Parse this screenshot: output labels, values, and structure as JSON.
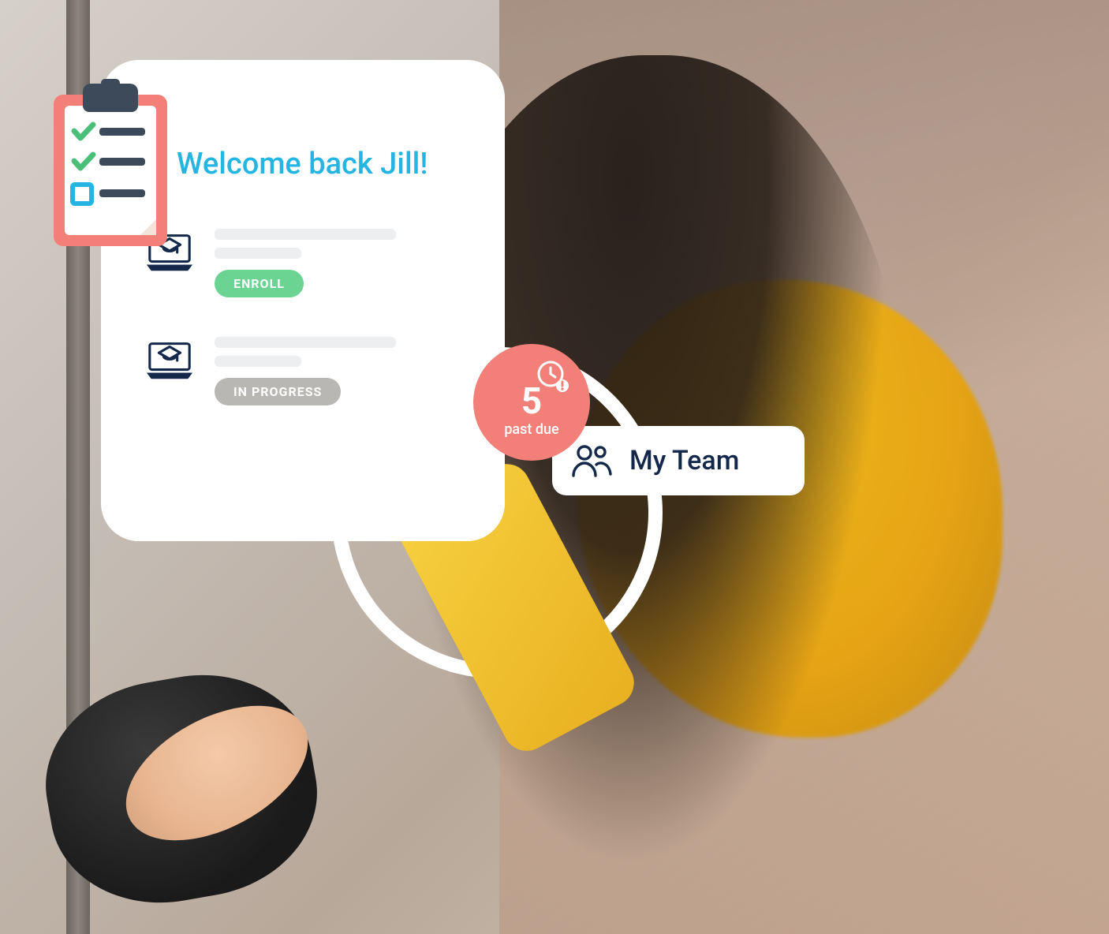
{
  "welcome": {
    "title": "Welcome back Jill!"
  },
  "courses": [
    {
      "status_label": "ENROLL",
      "status_kind": "enroll"
    },
    {
      "status_label": "IN PROGRESS",
      "status_kind": "progress"
    }
  ],
  "past_due": {
    "count": "5",
    "label": "past due"
  },
  "my_team": {
    "label": "My Team"
  },
  "colors": {
    "accent_cyan": "#25b5e2",
    "pill_green": "#6bd493",
    "pill_grey": "#b9b7b4",
    "badge_coral": "#f28079",
    "navy_text": "#14284b"
  }
}
